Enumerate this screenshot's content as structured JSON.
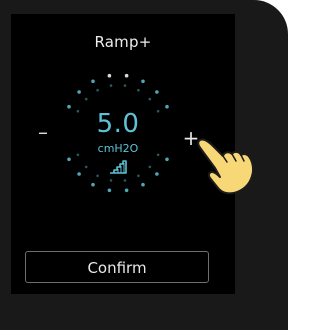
{
  "screen": {
    "title": "Ramp+"
  },
  "setting": {
    "value": "5.0",
    "unit": "cmH2O",
    "decrement_label": "–",
    "increment_label": "+"
  },
  "actions": {
    "confirm_label": "Confirm"
  },
  "colors": {
    "accent": "#5ec2d6",
    "hand": "#f8d776",
    "background": "#000000",
    "bezel": "#191919"
  },
  "icons": {
    "ramp": "ramp-stairs-icon",
    "hand": "pointing-hand-icon"
  }
}
